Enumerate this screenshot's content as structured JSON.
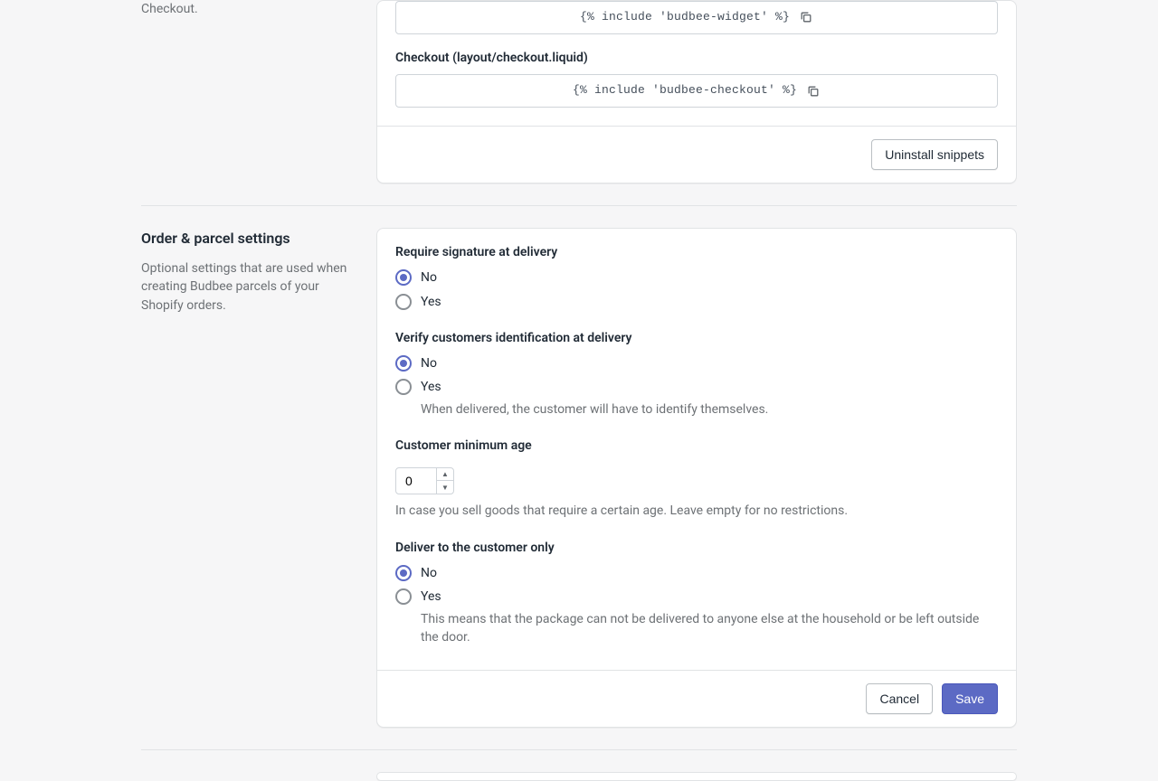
{
  "snippets": {
    "intro_fragment": "Checkout.",
    "widget_code": "{% include 'budbee-widget' %}",
    "checkout_label": "Checkout (layout/checkout.liquid)",
    "checkout_code": "{% include 'budbee-checkout' %}",
    "uninstall_label": "Uninstall snippets"
  },
  "order_settings": {
    "title": "Order & parcel settings",
    "description": "Optional settings that are used when creating Budbee parcels of your Shopify orders.",
    "signature": {
      "label": "Require signature at delivery",
      "no": "No",
      "yes": "Yes",
      "value": "no"
    },
    "verify_id": {
      "label": "Verify customers identification at delivery",
      "no": "No",
      "yes": "Yes",
      "yes_help": "When delivered, the customer will have to identify themselves.",
      "value": "no"
    },
    "min_age": {
      "label": "Customer minimum age",
      "value": "0",
      "help": "In case you sell goods that require a certain age. Leave empty for no restrictions."
    },
    "customer_only": {
      "label": "Deliver to the customer only",
      "no": "No",
      "yes": "Yes",
      "yes_help": "This means that the package can not be delivered to anyone else at the household or be left outside the door.",
      "value": "no"
    },
    "cancel_label": "Cancel",
    "save_label": "Save"
  }
}
